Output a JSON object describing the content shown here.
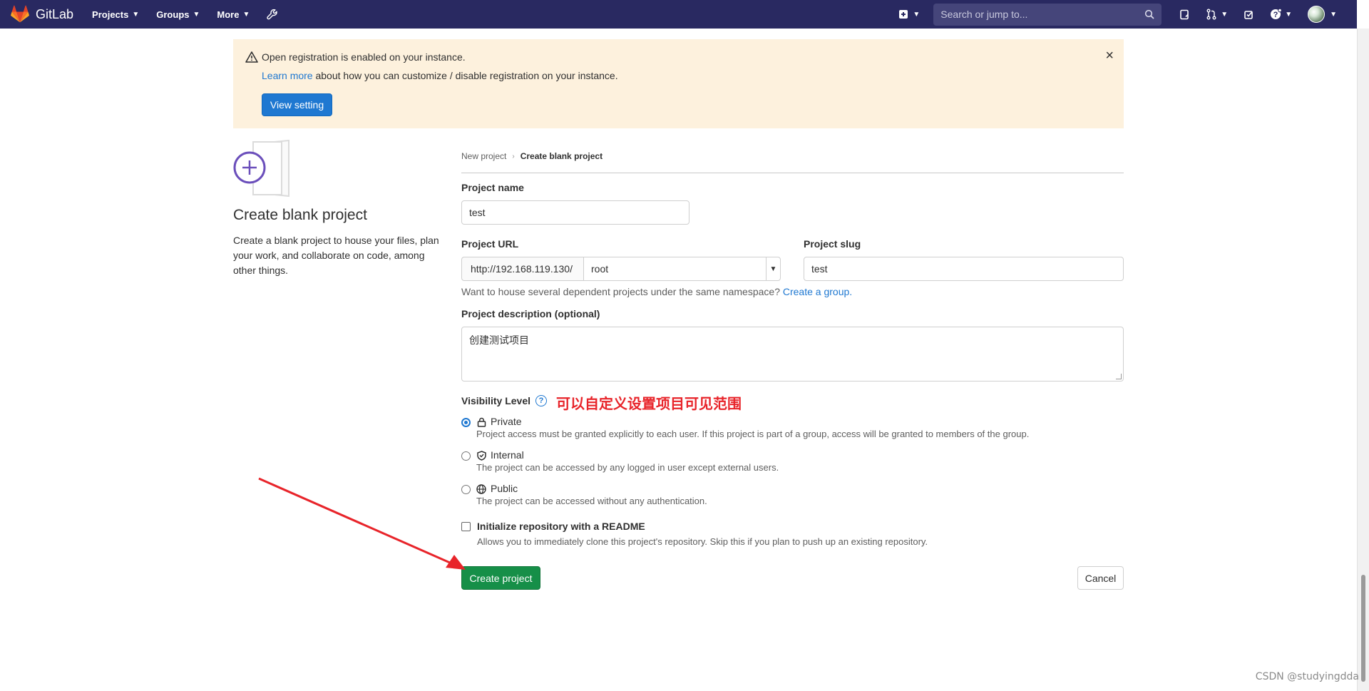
{
  "nav": {
    "brand": "GitLab",
    "items": [
      {
        "label": "Projects"
      },
      {
        "label": "Groups"
      },
      {
        "label": "More"
      }
    ],
    "search_placeholder": "Search or jump to..."
  },
  "banner": {
    "title": "Open registration is enabled on your instance.",
    "link_text": "Learn more",
    "text": " about how you can customize / disable registration on your instance.",
    "button": "View setting",
    "close": "×"
  },
  "left": {
    "title": "Create blank project",
    "description": "Create a blank project to house your files, plan your work, and collaborate on code, among other things."
  },
  "breadcrumb": {
    "items": [
      "New project",
      "Create blank project"
    ]
  },
  "form": {
    "project_name_label": "Project name",
    "project_name_value": "test",
    "project_url_label": "Project URL",
    "url_prefix": "http://192.168.119.130/",
    "namespace": "root",
    "project_slug_label": "Project slug",
    "project_slug_value": "test",
    "namespace_help": "Want to house several dependent projects under the same namespace? ",
    "create_group_link": "Create a group.",
    "description_label": "Project description (optional)",
    "description_value": "创建测试项目",
    "visibility_label": "Visibility Level",
    "visibility_help_icon": "?",
    "visibility_options": [
      {
        "title": "Private",
        "icon": "lock-icon",
        "desc": "Project access must be granted explicitly to each user. If this project is part of a group, access will be granted to members of the group.",
        "selected": true
      },
      {
        "title": "Internal",
        "icon": "shield-icon",
        "desc": "The project can be accessed by any logged in user except external users.",
        "selected": false
      },
      {
        "title": "Public",
        "icon": "globe-icon",
        "desc": "The project can be accessed without any authentication.",
        "selected": false
      }
    ],
    "readme_label": "Initialize repository with a README",
    "readme_desc": "Allows you to immediately clone this project's repository. Skip this if you plan to push up an existing repository.",
    "create_button": "Create project",
    "cancel_button": "Cancel"
  },
  "annotation": "可以自定义设置项目可见范围",
  "watermark": "CSDN @studyingdda",
  "colors": {
    "navbar": "#292961",
    "banner_bg": "#fdf1dd",
    "primary": "#1f78d1",
    "success": "#168f48",
    "annotation_red": "#e8242a"
  }
}
